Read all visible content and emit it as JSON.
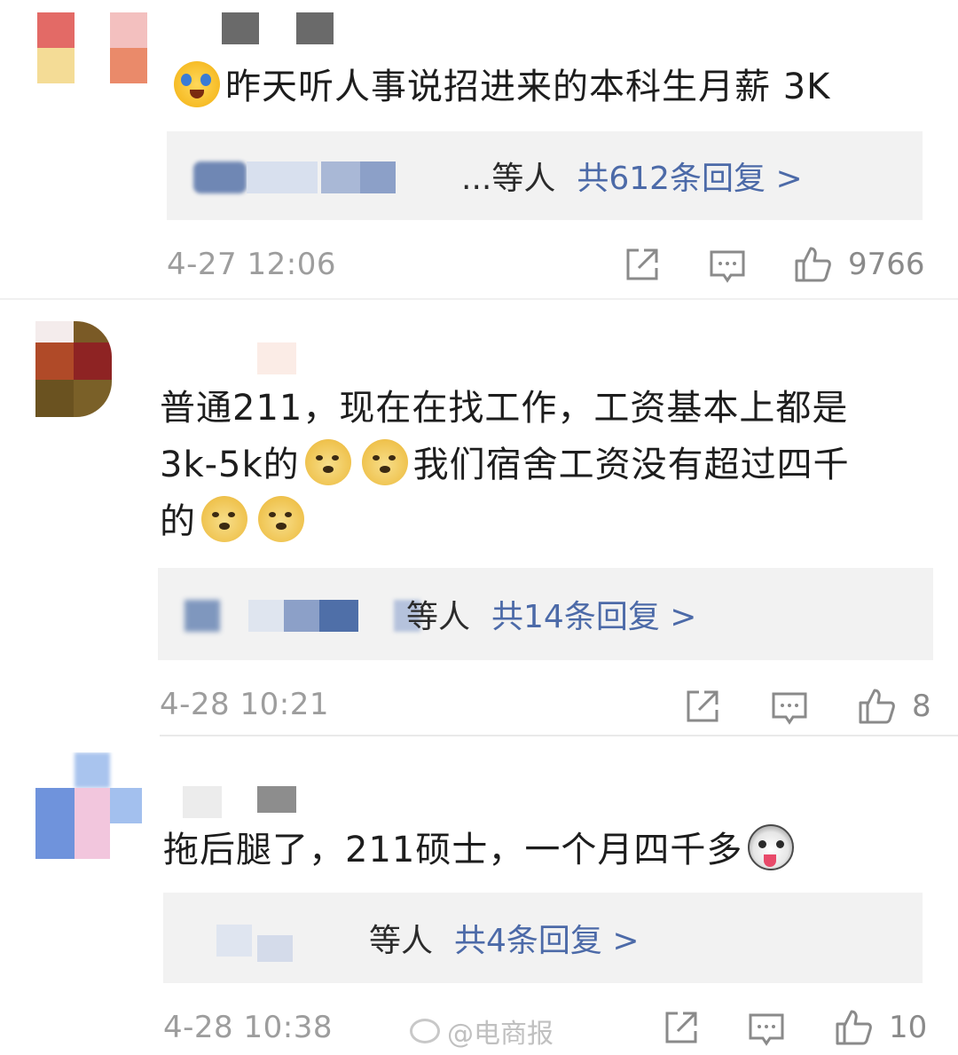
{
  "comments": [
    {
      "text": "昨天听人事说招进来的本科生月薪 3K",
      "emoji": "crying-emoji",
      "reply_etc": "...等人",
      "reply_total": "共612条回复 >",
      "time": "4-27 12:06",
      "likes": "9766"
    },
    {
      "text_line1": "普通211，现在在找工作，工资基本上都是",
      "text_line2_a": "3k-5k的",
      "text_line2_b": "我们宿舍工资没有超过四千",
      "text_line3": "的",
      "emoji": "doge-emoji",
      "reply_etc": "等人",
      "reply_total": "共14条回复 >",
      "time": "4-28 10:21",
      "likes": "8"
    },
    {
      "text": "拖后腿了，211硕士，一个月四千多",
      "emoji": "husky-emoji",
      "reply_etc": "等人",
      "reply_total": "共4条回复 >",
      "time": "4-28 10:38",
      "likes": "10"
    }
  ],
  "icons": [
    "share-icon",
    "comment-icon",
    "thumbs-up-icon"
  ],
  "watermark": "@电商报",
  "colors": {
    "reply_link": "#4c6aa8",
    "reply_bg": "#f2f2f2",
    "timestamp": "#9d9d9d"
  }
}
